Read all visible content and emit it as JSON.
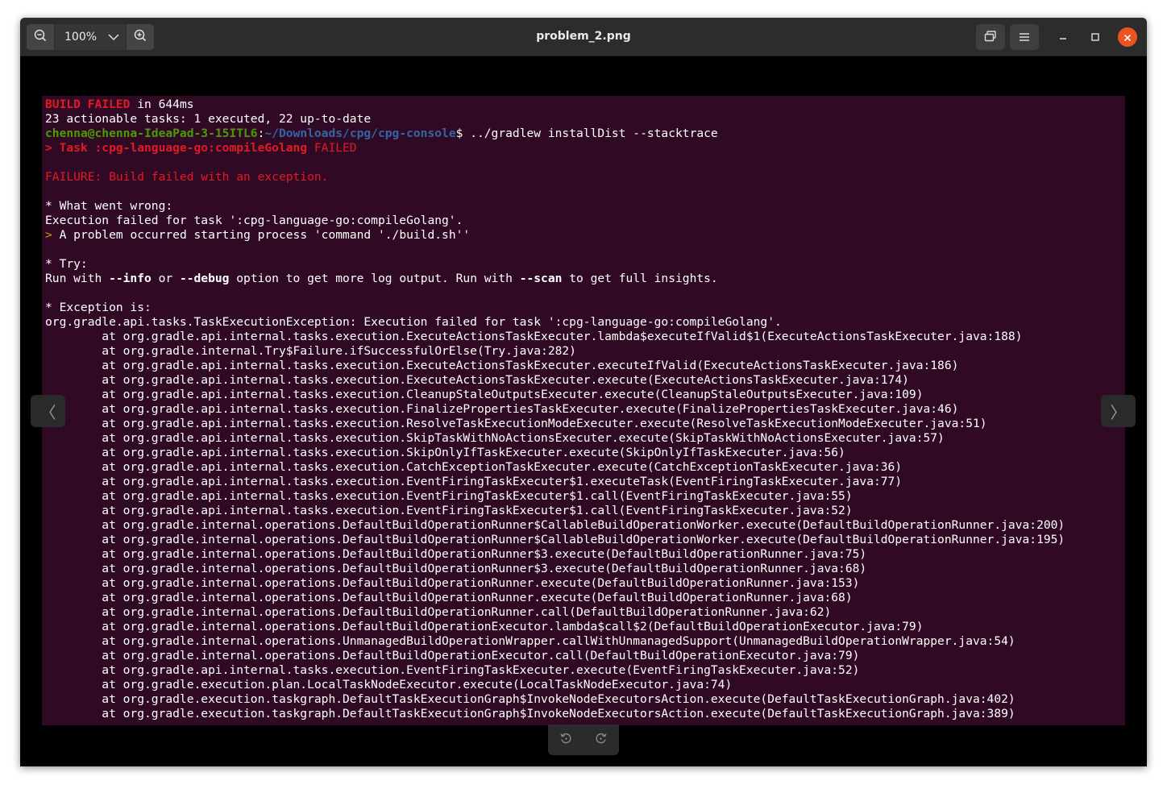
{
  "app": {
    "title": "problem_2.png",
    "zoom_level": "100%"
  },
  "icons": {
    "zoom_out": "zoom-out-icon",
    "zoom_in": "zoom-in-icon",
    "zoom_dropdown": "chevron-down-icon",
    "gallery": "gallery-icon",
    "menu": "hamburger-menu-icon",
    "minimize": "minimize-icon",
    "maximize": "maximize-icon",
    "close": "close-icon",
    "prev": "chevron-left-icon",
    "next": "chevron-right-icon",
    "rotate_left": "rotate-left-icon",
    "rotate_right": "rotate-right-icon"
  },
  "nav": {
    "prev_glyph": "〈",
    "next_glyph": "〉"
  },
  "colors": {
    "close_button": "#e95420",
    "terminal_bg": "#300a24",
    "error_red": "#e01b24"
  },
  "terminal": {
    "build_failed": "BUILD FAILED",
    "build_time": " in 644ms",
    "actionable": "23 actionable tasks: 1 executed, 22 up-to-date",
    "prompt_user": "chenna@chenna-IdeaPad-3-15ITL6",
    "prompt_sep": ":",
    "prompt_path": "~/Downloads/cpg/cpg-console",
    "prompt_cmd": "$ ../gradlew installDist --stacktrace",
    "task_line": "> Task :cpg-language-go:compileGolang",
    "task_status": " FAILED",
    "failure": "FAILURE: Build failed with an exception.",
    "what_wrong": "* What went wrong:",
    "exec_failed": "Execution failed for task ':cpg-language-go:compileGolang'.",
    "problem_arrow": ">",
    "problem": " A problem occurred starting process 'command './build.sh''",
    "try": "* Try:",
    "run_with": "Run with ",
    "opt_info": "--info",
    "or": " or ",
    "opt_debug": "--debug",
    "option_text": " option to get more log output. Run with ",
    "opt_scan": "--scan",
    "insights": " to get full insights.",
    "exception_is": "* Exception is:",
    "exception": "org.gradle.api.tasks.TaskExecutionException: Execution failed for task ':cpg-language-go:compileGolang'.",
    "stack": [
      "        at org.gradle.api.internal.tasks.execution.ExecuteActionsTaskExecuter.lambda$executeIfValid$1(ExecuteActionsTaskExecuter.java:188)",
      "        at org.gradle.internal.Try$Failure.ifSuccessfulOrElse(Try.java:282)",
      "        at org.gradle.api.internal.tasks.execution.ExecuteActionsTaskExecuter.executeIfValid(ExecuteActionsTaskExecuter.java:186)",
      "        at org.gradle.api.internal.tasks.execution.ExecuteActionsTaskExecuter.execute(ExecuteActionsTaskExecuter.java:174)",
      "        at org.gradle.api.internal.tasks.execution.CleanupStaleOutputsExecuter.execute(CleanupStaleOutputsExecuter.java:109)",
      "        at org.gradle.api.internal.tasks.execution.FinalizePropertiesTaskExecuter.execute(FinalizePropertiesTaskExecuter.java:46)",
      "        at org.gradle.api.internal.tasks.execution.ResolveTaskExecutionModeExecuter.execute(ResolveTaskExecutionModeExecuter.java:51)",
      "        at org.gradle.api.internal.tasks.execution.SkipTaskWithNoActionsExecuter.execute(SkipTaskWithNoActionsExecuter.java:57)",
      "        at org.gradle.api.internal.tasks.execution.SkipOnlyIfTaskExecuter.execute(SkipOnlyIfTaskExecuter.java:56)",
      "        at org.gradle.api.internal.tasks.execution.CatchExceptionTaskExecuter.execute(CatchExceptionTaskExecuter.java:36)",
      "        at org.gradle.api.internal.tasks.execution.EventFiringTaskExecuter$1.executeTask(EventFiringTaskExecuter.java:77)",
      "        at org.gradle.api.internal.tasks.execution.EventFiringTaskExecuter$1.call(EventFiringTaskExecuter.java:55)",
      "        at org.gradle.api.internal.tasks.execution.EventFiringTaskExecuter$1.call(EventFiringTaskExecuter.java:52)",
      "        at org.gradle.internal.operations.DefaultBuildOperationRunner$CallableBuildOperationWorker.execute(DefaultBuildOperationRunner.java:200)",
      "        at org.gradle.internal.operations.DefaultBuildOperationRunner$CallableBuildOperationWorker.execute(DefaultBuildOperationRunner.java:195)",
      "        at org.gradle.internal.operations.DefaultBuildOperationRunner$3.execute(DefaultBuildOperationRunner.java:75)",
      "        at org.gradle.internal.operations.DefaultBuildOperationRunner$3.execute(DefaultBuildOperationRunner.java:68)",
      "        at org.gradle.internal.operations.DefaultBuildOperationRunner.execute(DefaultBuildOperationRunner.java:153)",
      "        at org.gradle.internal.operations.DefaultBuildOperationRunner.execute(DefaultBuildOperationRunner.java:68)",
      "        at org.gradle.internal.operations.DefaultBuildOperationRunner.call(DefaultBuildOperationRunner.java:62)",
      "        at org.gradle.internal.operations.DefaultBuildOperationExecutor.lambda$call$2(DefaultBuildOperationExecutor.java:79)",
      "        at org.gradle.internal.operations.UnmanagedBuildOperationWrapper.callWithUnmanagedSupport(UnmanagedBuildOperationWrapper.java:54)",
      "        at org.gradle.internal.operations.DefaultBuildOperationExecutor.call(DefaultBuildOperationExecutor.java:79)",
      "        at org.gradle.api.internal.tasks.execution.EventFiringTaskExecuter.execute(EventFiringTaskExecuter.java:52)",
      "        at org.gradle.execution.plan.LocalTaskNodeExecutor.execute(LocalTaskNodeExecutor.java:74)",
      "        at org.gradle.execution.taskgraph.DefaultTaskExecutionGraph$InvokeNodeExecutorsAction.execute(DefaultTaskExecutionGraph.java:402)",
      "        at org.gradle.execution.taskgraph.DefaultTaskExecutionGraph$InvokeNodeExecutorsAction.execute(DefaultTaskExecutionGraph.java:389)"
    ]
  }
}
